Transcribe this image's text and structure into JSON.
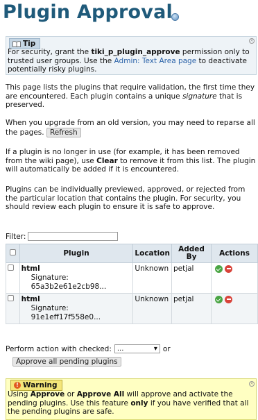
{
  "page": {
    "title": "Plugin Approval"
  },
  "tip": {
    "label": "Tip",
    "text_before": "For security, grant the ",
    "permission": "tiki_p_plugin_approve",
    "text_middle": " permission only to trusted user groups. Use the ",
    "link": "Admin: Text Area page",
    "text_after": " to deactivate potentially risky plugins."
  },
  "intro": {
    "p1_before": "This page lists the plugins that require validation, the first time they are encountered. Each plugin contains a unique ",
    "p1_em": "signature",
    "p1_after": " that is preserved.",
    "p2": "When you upgrade from an old version, you may need to reparse all the pages.",
    "refresh": "Refresh",
    "p3_before": "If a plugin is no longer in use (for example, it has been removed from the wiki page), use ",
    "p3_strong": "Clear",
    "p3_after": " to remove it from this list. The plugin will automatically be added if it is encountered.",
    "p4": "Plugins can be individually previewed, approved, or rejected from the particular location that contains the plugin. For security, you should review each plugin to ensure it is safe to approve."
  },
  "filter": {
    "label": "Filter:",
    "value": ""
  },
  "table": {
    "headers": {
      "plugin": "Plugin",
      "location": "Location",
      "added_by": "Added By",
      "actions": "Actions"
    },
    "rows": [
      {
        "name": "html",
        "signature_label": "Signature:",
        "signature": "65a3b2e61e2cb98...",
        "location": "Unknown",
        "added_by": "petjal"
      },
      {
        "name": "html",
        "signature_label": "Signature:",
        "signature": "91e1eff17f558e0...",
        "location": "Unknown",
        "added_by": "petjal"
      }
    ]
  },
  "bulk": {
    "label": "Perform action with checked:",
    "selected": "...",
    "or": "or",
    "approve_all": "Approve all pending plugins"
  },
  "warning": {
    "label": "Warning",
    "t1": "Using ",
    "s1": "Approve",
    "t2": " or ",
    "s2": "Approve All",
    "t3": " will approve and activate the pending plugins. Use this feature ",
    "s3": "only",
    "t4": " if you have verified that all the pending plugins are safe."
  },
  "colors": {
    "title": "#1f5a7a",
    "link": "#2a62a8",
    "tip_bg": "#eef3f7",
    "warning_bg": "#ffffc2",
    "approve": "#4aa544",
    "reject": "#d8433a"
  }
}
